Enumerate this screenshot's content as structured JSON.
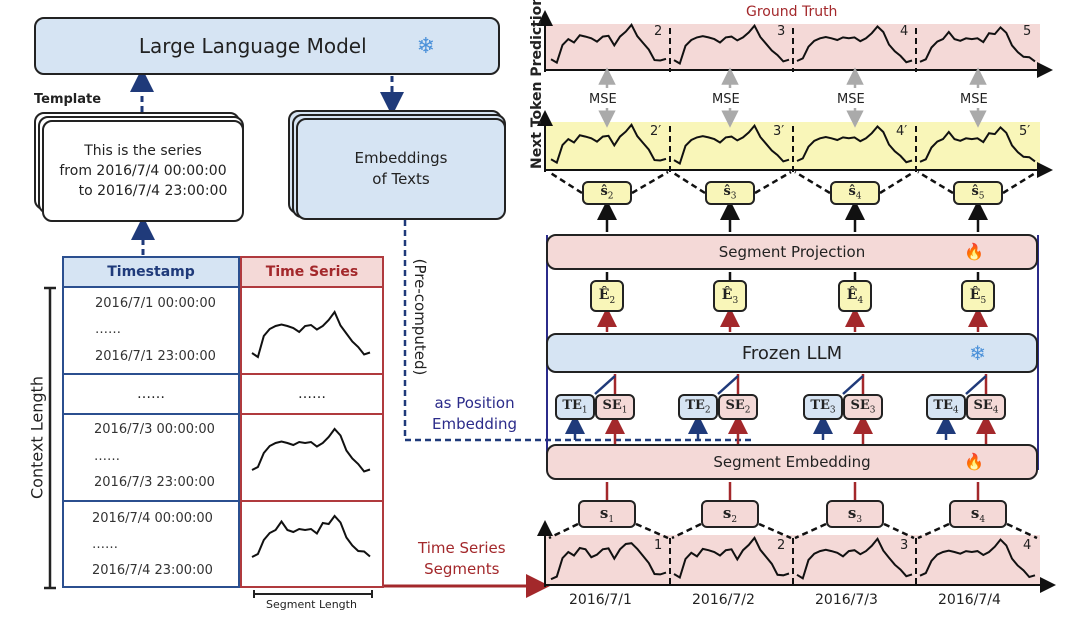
{
  "llm": {
    "title": "Large Language Model",
    "icon": "snowflake-icon"
  },
  "template": {
    "label": "Template",
    "lines": [
      "This is the series",
      "from 2016/7/4 00:00:00",
      "to 2016/7/4 23:00:00"
    ]
  },
  "embeddings": {
    "lines": [
      "Embeddings",
      "of Texts"
    ]
  },
  "table": {
    "headers": {
      "timestamp": "Timestamp",
      "series": "Time Series"
    },
    "rows": [
      {
        "start": "2016/7/1  00:00:00",
        "dots": "……",
        "end": "2016/7/1  23:00:00"
      },
      {
        "ellipsis": "……",
        "series_ellipsis": "……"
      },
      {
        "start": "2016/7/3  00:00:00",
        "dots": "……",
        "end": "2016/7/3  23:00:00"
      },
      {
        "start": "2016/7/4  00:00:00",
        "dots": "……",
        "end": "2016/7/4  23:00:00"
      }
    ],
    "context_length": "Context Length",
    "segment_length": "Segment Length"
  },
  "precomputed": "(Pre-computed)",
  "position_embedding": [
    "as Position",
    "Embedding"
  ],
  "ts_segments_label": [
    "Time Series",
    "Segments"
  ],
  "next_token_prediction": "Next Token Prediction",
  "ground_truth": {
    "label": "Ground Truth",
    "markers": [
      "2",
      "3",
      "4",
      "5"
    ]
  },
  "prediction": {
    "markers": [
      "2′",
      "3′",
      "4′",
      "5′"
    ]
  },
  "mse": [
    "MSE",
    "MSE",
    "MSE",
    "MSE"
  ],
  "s_hat": [
    "ŝ",
    "ŝ",
    "ŝ",
    "ŝ"
  ],
  "s_hat_sub": [
    "2",
    "3",
    "4",
    "5"
  ],
  "segment_projection": {
    "label": "Segment Projection",
    "icon": "fire-icon"
  },
  "e_hat": [
    "Ê",
    "Ê",
    "Ê",
    "Ê"
  ],
  "e_hat_sub": [
    "2",
    "3",
    "4",
    "5"
  ],
  "frozen_llm": {
    "label": "Frozen LLM",
    "icon": "snowflake-icon"
  },
  "te": {
    "label": "TE",
    "subs": [
      "1",
      "2",
      "3",
      "4"
    ]
  },
  "se": {
    "label": "SE",
    "subs": [
      "1",
      "2",
      "3",
      "4"
    ]
  },
  "segment_embedding": {
    "label": "Segment Embedding",
    "icon": "fire-icon"
  },
  "s": {
    "label": "s",
    "subs": [
      "1",
      "2",
      "3",
      "4"
    ]
  },
  "input_markers": [
    "1",
    "2",
    "3",
    "4"
  ],
  "dates": [
    "2016/7/1",
    "2016/7/2",
    "2016/7/3",
    "2016/7/4"
  ],
  "colors": {
    "blue": "#d6e4f3",
    "pink": "#f4d9d7",
    "yellow": "#f9f6b9",
    "navy": "#1f3a7a",
    "red": "#a3282b"
  }
}
